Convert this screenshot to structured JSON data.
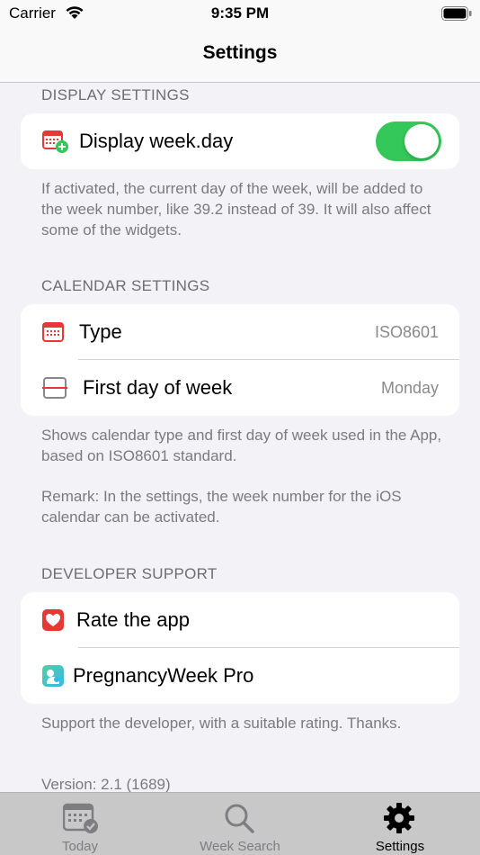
{
  "status_bar": {
    "carrier": "Carrier",
    "time": "9:35 PM"
  },
  "nav": {
    "title": "Settings"
  },
  "display_settings": {
    "header": "DISPLAY SETTINGS",
    "row_label": "Display week.day",
    "toggle_on": true,
    "footer": "If activated, the current day of the week, will be added to the week number, like 39.2 instead of 39. It will also affect some of the widgets."
  },
  "calendar_settings": {
    "header": "CALENDAR SETTINGS",
    "type_label": "Type",
    "type_value": "ISO8601",
    "first_day_label": "First day of week",
    "first_day_value": "Monday",
    "footer": "Shows calendar type and first day of week used in the App, based on ISO8601 standard.",
    "remark": "Remark: In the settings, the week number for the iOS calendar can be activated."
  },
  "developer_support": {
    "header": "DEVELOPER SUPPORT",
    "rate_label": "Rate the app",
    "pro_label": "PregnancyWeek Pro",
    "footer": "Support the developer, with a suitable rating. Thanks.",
    "version": "Version: 2.1 (1689)"
  },
  "tab_bar": {
    "tabs": [
      {
        "label": "Today",
        "icon": "calendar-check-icon"
      },
      {
        "label": "Week Search",
        "icon": "magnifier-icon"
      },
      {
        "label": "Settings",
        "icon": "gear-icon"
      }
    ],
    "active": "Settings"
  },
  "colors": {
    "toggle_on": "#34c759",
    "icon_red": "#e53935",
    "background": "#f2f2f7"
  }
}
